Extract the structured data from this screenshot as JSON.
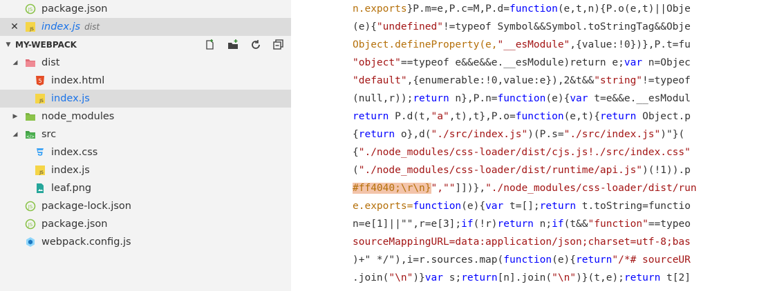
{
  "explorer": {
    "open_editors": [
      {
        "label": "package.json",
        "icon": "json-file-icon",
        "active": false
      },
      {
        "label": "index.js",
        "sublabel": "dist",
        "icon": "js-file-icon",
        "active": true
      }
    ],
    "section_title": "MY-WEBPACK",
    "toolbar_icons": [
      "new-file-icon",
      "new-folder-icon",
      "refresh-icon",
      "collapse-all-icon"
    ],
    "tree": [
      {
        "label": "dist",
        "type": "folder",
        "expanded": true,
        "depth": 1,
        "icon": "dist-folder-icon"
      },
      {
        "label": "index.html",
        "type": "file",
        "depth": 2,
        "icon": "html-file-icon"
      },
      {
        "label": "index.js",
        "type": "file",
        "depth": 2,
        "icon": "js-file-icon",
        "selected": true
      },
      {
        "label": "node_modules",
        "type": "folder",
        "expanded": false,
        "depth": 1,
        "icon": "node-folder-icon"
      },
      {
        "label": "src",
        "type": "folder",
        "expanded": true,
        "depth": 1,
        "icon": "src-folder-icon"
      },
      {
        "label": "index.css",
        "type": "file",
        "depth": 2,
        "icon": "css-file-icon"
      },
      {
        "label": "index.js",
        "type": "file",
        "depth": 2,
        "icon": "js-file-icon"
      },
      {
        "label": "leaf.png",
        "type": "file",
        "depth": 2,
        "icon": "image-file-icon"
      },
      {
        "label": "package-lock.json",
        "type": "file",
        "depth": 1,
        "icon": "json-file-icon"
      },
      {
        "label": "package.json",
        "type": "file",
        "depth": 1,
        "icon": "json-file-icon"
      },
      {
        "label": "webpack.config.js",
        "type": "file",
        "depth": 1,
        "icon": "webpack-file-icon"
      }
    ]
  },
  "editor": {
    "lines": [
      [
        [
          "n.exports",
          "r"
        ],
        [
          "}P.m=e,P.c=M,P.d=",
          "d"
        ],
        [
          "function",
          "b"
        ],
        [
          "(e,t,n){P.o(e,t)||Obje",
          "d"
        ]
      ],
      [
        [
          "(e){",
          "d"
        ],
        [
          "\"undefined\"",
          "s"
        ],
        [
          "!=typeof Symbol&&Symbol.toStringTag&&Obje",
          "d"
        ]
      ],
      [
        [
          "Object.defineProperty(e,",
          "r"
        ],
        [
          "\"__esModule\"",
          "s"
        ],
        [
          ",{value:!0})},P.t=fu",
          "d"
        ]
      ],
      [
        [
          "\"object\"",
          "s"
        ],
        [
          "==typeof e&&e&&e.__esModule)return e;",
          "d"
        ],
        [
          "var",
          "b"
        ],
        [
          " n=Objec",
          "d"
        ]
      ],
      [
        [
          "\"default\"",
          "s"
        ],
        [
          ",{enumerable:!0,value:e}),2&t&&",
          "d"
        ],
        [
          "\"string\"",
          "s"
        ],
        [
          "!=typeof",
          "d"
        ]
      ],
      [
        [
          "(null,r));",
          "d"
        ],
        [
          "return",
          "b"
        ],
        [
          " n},P.n=",
          "d"
        ],
        [
          "function",
          "b"
        ],
        [
          "(e){",
          "d"
        ],
        [
          "var",
          "b"
        ],
        [
          " t=e&&e.__esModul",
          "d"
        ]
      ],
      [
        [
          "return",
          "b"
        ],
        [
          " P.d(t,",
          "d"
        ],
        [
          "\"a\"",
          "s"
        ],
        [
          ",t),t},P.o=",
          "d"
        ],
        [
          "function",
          "b"
        ],
        [
          "(e,t){",
          "d"
        ],
        [
          "return",
          "b"
        ],
        [
          " Object.p",
          "d"
        ]
      ],
      [
        [
          "{",
          "d"
        ],
        [
          "return",
          "b"
        ],
        [
          " o},d(",
          "d"
        ],
        [
          "\"./src/index.js\"",
          "s"
        ],
        [
          ")(P.s=",
          "d"
        ],
        [
          "\"./src/index.js\"",
          "s"
        ],
        [
          ")\"}(",
          "d"
        ]
      ],
      [
        [
          "{",
          "d"
        ],
        [
          "\"./node_modules/css-loader/dist/cjs.js!./src/index.css\"",
          "s"
        ]
      ],
      [
        [
          "(",
          "d"
        ],
        [
          "\"./node_modules/css-loader/dist/runtime/api.js\"",
          "s"
        ],
        [
          ")(!1)).p",
          "d"
        ]
      ],
      [
        [
          "#ff4040;\\r\\n}",
          "h"
        ],
        [
          "\",\"\"",
          "s"
        ],
        [
          "]])},",
          "d"
        ],
        [
          "\"./node_modules/css-loader/dist/run",
          "s"
        ]
      ],
      [
        [
          "e.exports=",
          "r"
        ],
        [
          "function",
          "b"
        ],
        [
          "(e){",
          "d"
        ],
        [
          "var",
          "b"
        ],
        [
          " t=[];",
          "d"
        ],
        [
          "return",
          "b"
        ],
        [
          " t.toString=functio",
          "d"
        ]
      ],
      [
        [
          "n=e[1]||\"\",r=e[3];",
          "d"
        ],
        [
          "if",
          "b"
        ],
        [
          "(!r)",
          "d"
        ],
        [
          "return",
          "b"
        ],
        [
          " n;",
          "d"
        ],
        [
          "if",
          "b"
        ],
        [
          "(t&&",
          "d"
        ],
        [
          "\"function\"",
          "s"
        ],
        [
          "==typeo",
          "d"
        ]
      ],
      [
        [
          "sourceMappingURL=data:application/json;charset=utf-8;bas",
          "s"
        ]
      ],
      [
        [
          ")+\" */\"),i=r.sources.map(",
          "d"
        ],
        [
          "function",
          "b"
        ],
        [
          "(e){",
          "d"
        ],
        [
          "return",
          "b"
        ],
        [
          "\"/*# sourceUR",
          "s"
        ]
      ],
      [
        [
          ".join(",
          "d"
        ],
        [
          "\"\\n\"",
          "s"
        ],
        [
          ")}",
          "d"
        ],
        [
          "var",
          "b"
        ],
        [
          " s;",
          "d"
        ],
        [
          "return",
          "b"
        ],
        [
          "[n].join(",
          "d"
        ],
        [
          "\"\\n\"",
          "s"
        ],
        [
          ")}(t,e);",
          "d"
        ],
        [
          "return",
          "b"
        ],
        [
          " t[2]",
          "d"
        ]
      ]
    ]
  },
  "colors": {
    "keyword": "#0000ff",
    "string": "#a31515",
    "member": "#b5700a",
    "default": "#333333",
    "highlight_bg": "#f3c4aa",
    "accent": "#1a73e8"
  }
}
